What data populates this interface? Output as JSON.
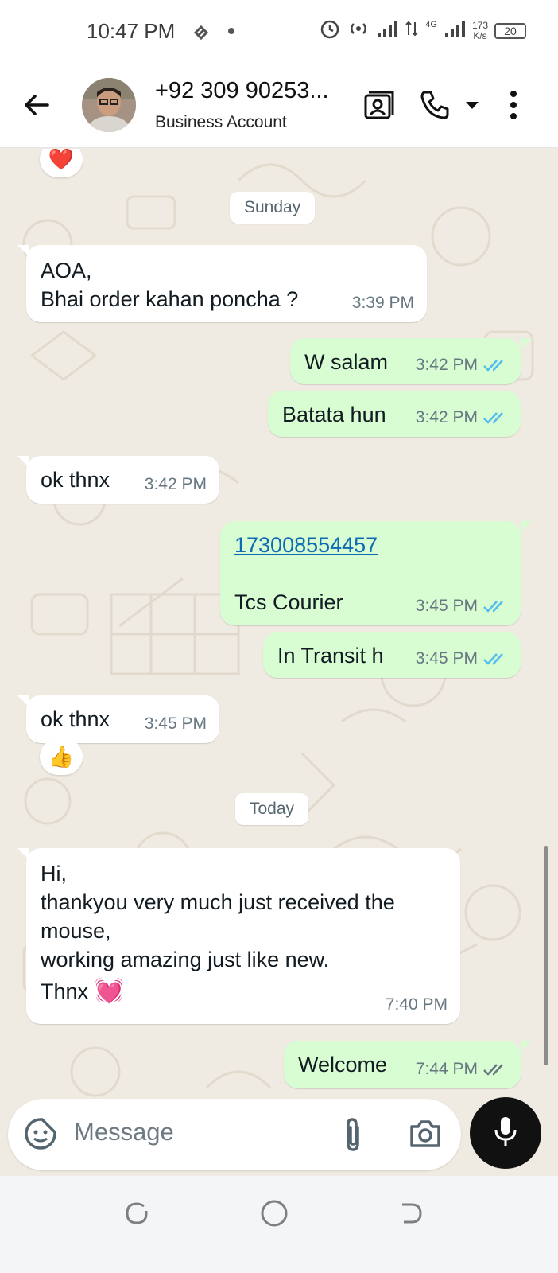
{
  "status_bar": {
    "time": "10:47 PM",
    "network_type": "4G",
    "speed_value": "173",
    "speed_unit": "K/s",
    "battery": "20"
  },
  "header": {
    "contact_name": "+92 309 90253...",
    "subtitle": "Business Account",
    "icons": [
      "back-arrow-icon",
      "contact-card-icon",
      "phone-icon",
      "dropdown-icon",
      "more-vert-icon"
    ]
  },
  "messages": [
    {
      "kind": "reaction",
      "emoji": "❤️"
    },
    {
      "kind": "date",
      "text": "Sunday"
    },
    {
      "kind": "incoming",
      "lines": [
        "AOA,",
        "Bhai order kahan poncha ?"
      ],
      "time": "3:39 PM"
    },
    {
      "kind": "outgoing",
      "text": "W salam",
      "time": "3:42 PM",
      "status": "read"
    },
    {
      "kind": "outgoing",
      "text": "Batata hun",
      "time": "3:42 PM",
      "status": "read"
    },
    {
      "kind": "incoming",
      "text": "ok thnx",
      "time": "3:42 PM"
    },
    {
      "kind": "outgoing",
      "link": "173008554457",
      "text": "Tcs Courier",
      "time": "3:45 PM",
      "status": "read"
    },
    {
      "kind": "outgoing",
      "text": "In Transit h",
      "time": "3:45 PM",
      "status": "read"
    },
    {
      "kind": "incoming",
      "text": "ok thnx",
      "time": "3:45 PM",
      "reaction": "👍"
    },
    {
      "kind": "date",
      "text": "Today"
    },
    {
      "kind": "incoming",
      "lines": [
        "Hi,",
        "thankyou very much just received the",
        "mouse,",
        "working amazing just like new.",
        "Thnx"
      ],
      "emoji": "💓",
      "time": "7:40 PM"
    },
    {
      "kind": "outgoing",
      "text": "Welcome",
      "time": "7:44 PM",
      "status": "delivered"
    }
  ],
  "composer": {
    "placeholder": "Message",
    "icons": [
      "sticker-icon",
      "attach-icon",
      "camera-icon",
      "mic-icon"
    ]
  },
  "colors": {
    "chat_background": "#efeae2",
    "outgoing_bubble": "#d9fdd3",
    "incoming_bubble": "#ffffff",
    "read_ticks": "#53bdeb",
    "link": "#0d6ab3"
  }
}
